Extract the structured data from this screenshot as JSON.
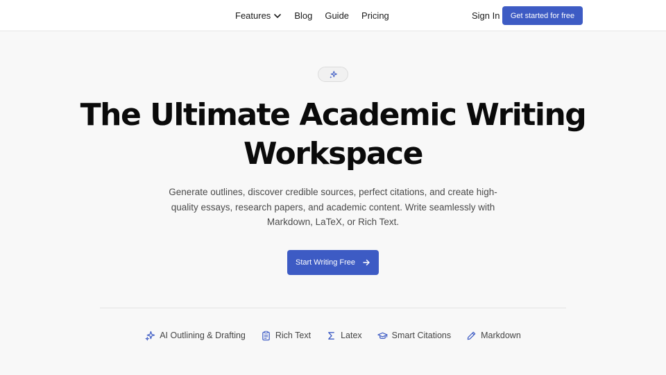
{
  "nav": {
    "links": [
      {
        "label": "Features",
        "has_dropdown": true
      },
      {
        "label": "Blog"
      },
      {
        "label": "Guide"
      },
      {
        "label": "Pricing"
      }
    ],
    "signin_label": "Sign In",
    "cta_label": "Get started for free"
  },
  "hero": {
    "badge_icon": "sparkles-icon",
    "title_line1": "The Ultimate Academic Writing",
    "title_line2": "Workspace",
    "subtitle": "Generate outlines, discover credible sources, perfect citations, and create high-quality essays, research papers, and academic content. Write seamlessly with Markdown, LaTeX, or Rich Text.",
    "cta_label": "Start Writing Free"
  },
  "features": [
    {
      "icon": "sparkles-icon",
      "label": "AI Outlining & Drafting"
    },
    {
      "icon": "clipboard-icon",
      "label": "Rich Text"
    },
    {
      "icon": "sigma-icon",
      "label": "Latex"
    },
    {
      "icon": "graduation-cap-icon",
      "label": "Smart Citations"
    },
    {
      "icon": "pencil-icon",
      "label": "Markdown"
    }
  ],
  "colors": {
    "accent": "#3d5bc4",
    "background": "#f8f8f8",
    "nav_background": "#ffffff"
  }
}
